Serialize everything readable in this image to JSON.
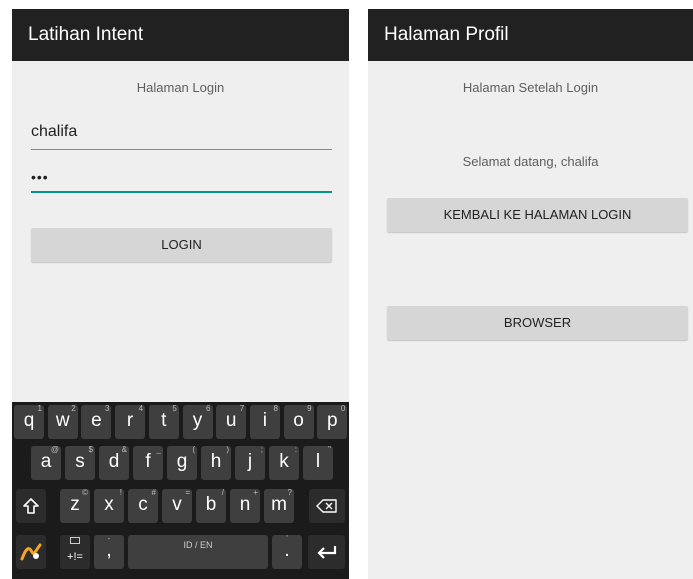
{
  "login_screen": {
    "appbar_title": "Latihan Intent",
    "page_caption": "Halaman Login",
    "username_value": "chalifa",
    "password_value": "•••",
    "login_button": "LOGIN",
    "keyboard": {
      "row1": [
        {
          "key": "q",
          "hint": "1"
        },
        {
          "key": "w",
          "hint": "2"
        },
        {
          "key": "e",
          "hint": "3"
        },
        {
          "key": "r",
          "hint": "4"
        },
        {
          "key": "t",
          "hint": "5"
        },
        {
          "key": "y",
          "hint": "6"
        },
        {
          "key": "u",
          "hint": "7"
        },
        {
          "key": "i",
          "hint": "8"
        },
        {
          "key": "o",
          "hint": "9"
        },
        {
          "key": "p",
          "hint": "0"
        }
      ],
      "row2": [
        {
          "key": "a",
          "hint": "@"
        },
        {
          "key": "s",
          "hint": "$"
        },
        {
          "key": "d",
          "hint": "&"
        },
        {
          "key": "f",
          "hint": "_"
        },
        {
          "key": "g",
          "hint": "("
        },
        {
          "key": "h",
          "hint": ")"
        },
        {
          "key": "j",
          "hint": ";"
        },
        {
          "key": "k",
          "hint": ":"
        },
        {
          "key": "l",
          "hint": "\""
        }
      ],
      "row3": [
        {
          "key": "z",
          "hint": "©"
        },
        {
          "key": "x",
          "hint": "!"
        },
        {
          "key": "c",
          "hint": "#"
        },
        {
          "key": "v",
          "hint": "="
        },
        {
          "key": "b",
          "hint": "/"
        },
        {
          "key": "n",
          "hint": "+"
        },
        {
          "key": "m",
          "hint": "?"
        }
      ],
      "symbols_key": "+!=",
      "comma_key": ",",
      "comma_hint": "-",
      "space_label": "ID / EN",
      "period_key": ".",
      "period_hint": "'"
    }
  },
  "profile_screen": {
    "appbar_title": "Halaman Profil",
    "page_caption": "Halaman Setelah Login",
    "welcome_text": "Selamat datang, chalifa",
    "back_button": "KEMBALI KE HALAMAN LOGIN",
    "browser_button": "BROWSER"
  },
  "colors": {
    "appbar": "#212121",
    "background": "#efefef",
    "accent": "#009688",
    "button": "#d6d6d6",
    "keyboard": "#1b1b1b",
    "key": "#3f3f3f",
    "swype_logo": "#f5a623"
  },
  "icons": [
    "shift-icon",
    "backspace-icon",
    "swype-logo-icon",
    "emoji-keyboard-icon",
    "enter-icon"
  ]
}
